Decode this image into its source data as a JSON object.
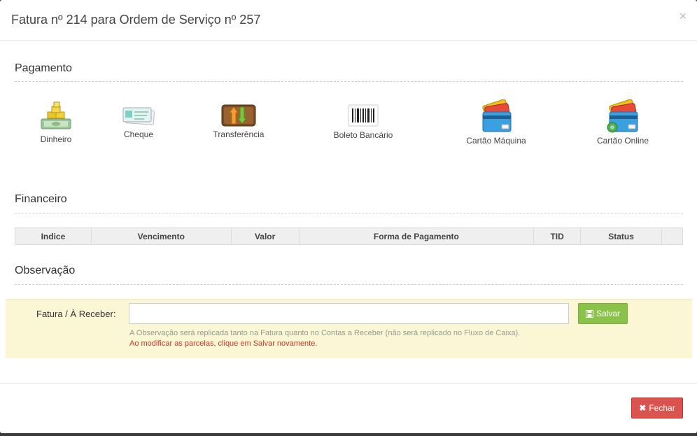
{
  "modal": {
    "title": "Fatura nº 214 para Ordem de Serviço nº 257",
    "close_symbol": "×"
  },
  "pagamento": {
    "title": "Pagamento",
    "methods": [
      {
        "label": "Dinheiro",
        "icon": "cash-icon"
      },
      {
        "label": "Cheque",
        "icon": "check-icon"
      },
      {
        "label": "Transferência",
        "icon": "transfer-icon"
      },
      {
        "label": "Boleto Bancário",
        "icon": "barcode-icon"
      },
      {
        "label": "Cartão Máquina",
        "icon": "card-machine-icon"
      },
      {
        "label": "Cartão Online",
        "icon": "card-online-icon"
      }
    ]
  },
  "financeiro": {
    "title": "Financeiro",
    "columns": [
      "Indice",
      "Vencimento",
      "Valor",
      "Forma de Pagamento",
      "TID",
      "Status"
    ]
  },
  "observacao": {
    "title": "Observação",
    "label": "Fatura / À Receber:",
    "value": "",
    "save_label": "Salvar",
    "help_text": "A Observação será replicada tanto na Fatura quanto no Contas a Receber (não será replicado no Fluxo de Caixa).",
    "warning_text": "Ao modificar as parcelas, clique em Salvar novamente."
  },
  "footer": {
    "close_label": "Fechar"
  },
  "colors": {
    "save_button": "#8bc34a",
    "close_button": "#d9534f",
    "observation_bg": "#fbf6d3",
    "warning_text": "#c0392b"
  }
}
